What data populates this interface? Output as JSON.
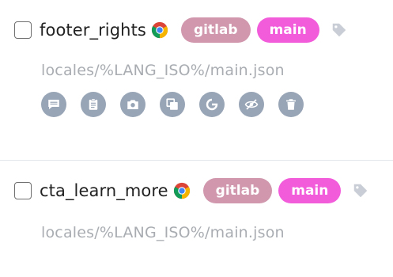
{
  "keys": [
    {
      "name": "footer_rights",
      "platform_icon": "chrome-icon",
      "tags": [
        "gitlab",
        "main"
      ],
      "file_path": "locales/%LANG_ISO%/main.json",
      "actions": [
        "comment-icon",
        "clipboard-icon",
        "screenshot-icon",
        "copy-icon",
        "google-translate-icon",
        "hidden-icon",
        "delete-icon"
      ]
    },
    {
      "name": "cta_learn_more",
      "platform_icon": "chrome-icon",
      "tags": [
        "gitlab",
        "main"
      ],
      "file_path": "locales/%LANG_ISO%/main.json"
    }
  ],
  "colors": {
    "tag_gitlab": "#d097ad",
    "tag_main": "#f25cdb",
    "action_button": "#98a5b6",
    "file_path_text": "#a9adb2"
  }
}
